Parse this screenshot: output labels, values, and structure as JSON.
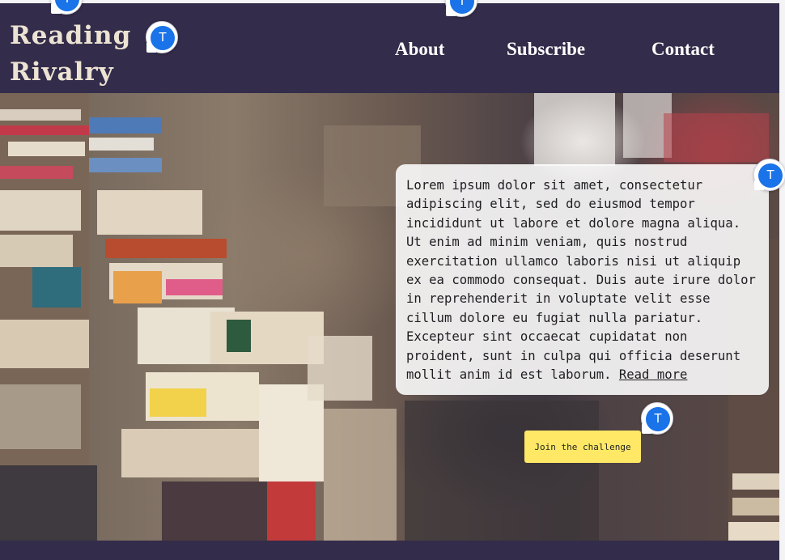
{
  "site": {
    "logo_line1": "Reading",
    "logo_line2": "Rivalry"
  },
  "nav": {
    "about": "About",
    "subscribe": "Subscribe",
    "contact": "Contact"
  },
  "hero": {
    "paragraph": "Lorem ipsum dolor sit amet, consectetur adipiscing elit, sed do eiusmod tempor incididunt ut labore et dolore magna aliqua. Ut enim ad minim veniam, quis nostrud exercitation ullamco laboris nisi ut aliquip ex ea commodo consequat. Duis aute irure dolor in reprehenderit in voluptate velit esse cillum dolore eu fugiat nulla pariatur. Excepteur sint occaecat cupidatat non proident, sunt in culpa qui officia deserunt mollit anim id est laborum.",
    "read_more": "Read more",
    "cta_label": "Join the challenge",
    "background_image": "stacks-of-books-photo"
  },
  "badges": {
    "letter": "T"
  },
  "colors": {
    "header_bg": "#332c4a",
    "logo_text": "#ece3d3",
    "nav_text": "#ffffff",
    "cta_bg": "#ffe866",
    "badge_blue": "#1a73e8"
  }
}
